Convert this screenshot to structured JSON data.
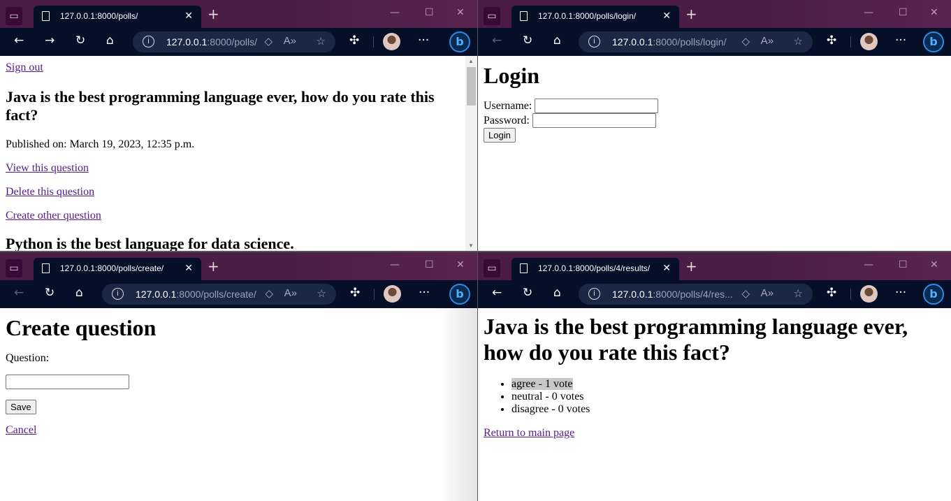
{
  "windows": {
    "tl": {
      "tab_title": "127.0.0.1:8000/polls/",
      "url_host": "127.0.0.1",
      "url_path": ":8000/polls/",
      "sign_out": "Sign out",
      "question_1": "Java is the best programming language ever, how do you rate this fact?",
      "published": "Published on: March 19, 2023, 12:35 p.m.",
      "view_link": "View this question",
      "delete_link": "Delete this question",
      "create_link": "Create other question",
      "question_2": "Python is the best language for data science."
    },
    "tr": {
      "tab_title": "127.0.0.1:8000/polls/login/",
      "url_host": "127.0.0.1",
      "url_path": ":8000/polls/login/",
      "heading": "Login",
      "username_label": "Username:",
      "username_value": "",
      "password_label": "Password:",
      "password_value": "",
      "login_button": "Login"
    },
    "bl": {
      "tab_title": "127.0.0.1:8000/polls/create/",
      "url_host": "127.0.0.1",
      "url_path": ":8000/polls/create/",
      "heading": "Create question",
      "question_label": "Question:",
      "question_value": "",
      "save_button": "Save",
      "cancel_link": "Cancel"
    },
    "br": {
      "tab_title": "127.0.0.1:8000/polls/4/results/",
      "url_host": "127.0.0.1",
      "url_path": ":8000/polls/4/res...",
      "heading": "Java is the best programming language ever, how do you rate this fact?",
      "results": [
        "agree - 1 vote",
        "neutral - 0 votes",
        "disagree - 0 votes"
      ],
      "return_link": "Return to main page"
    }
  },
  "colors": {
    "tab_bar": "#4a1c44",
    "toolbar": "#050f28",
    "link": "#551a8b"
  }
}
